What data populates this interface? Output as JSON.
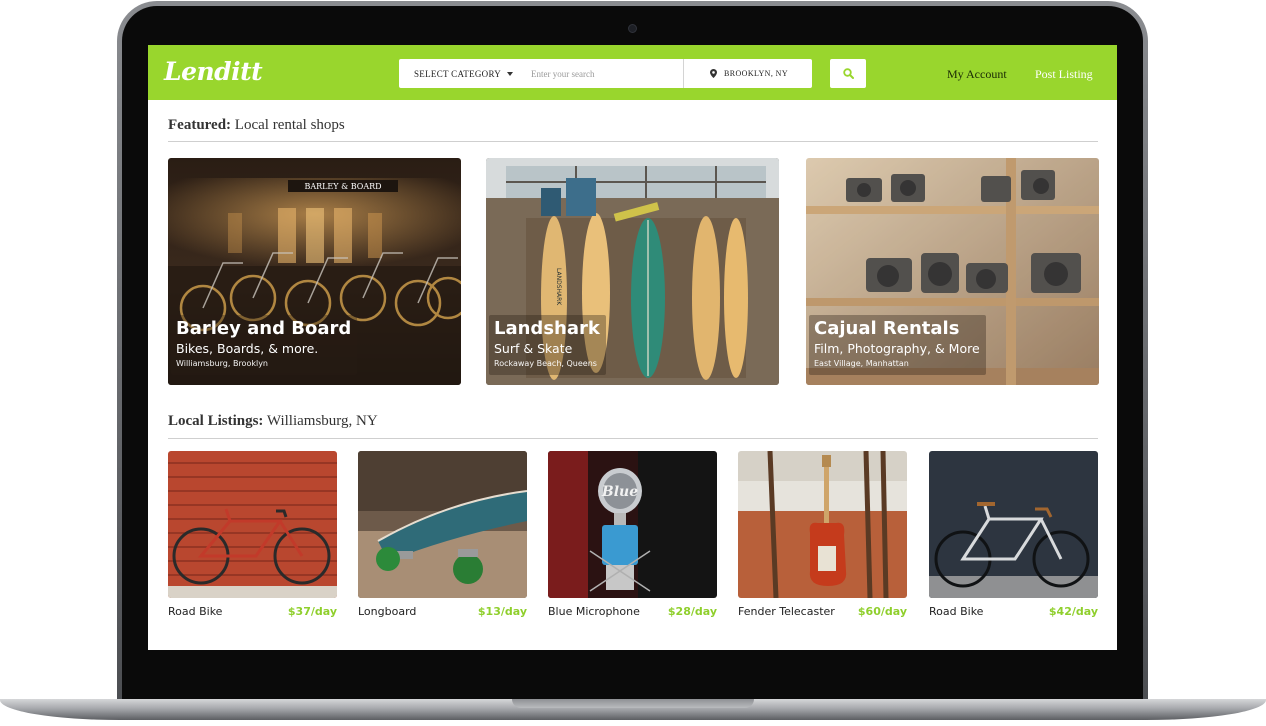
{
  "app": {
    "logo_text": "Lenditt",
    "accent_color": "#99d62d",
    "price_color": "#8fcf2c"
  },
  "header": {
    "category_label": "SELECT CATEGORY",
    "search_placeholder": "Enter your search",
    "location_label": "BROOKLYN, NY",
    "search_button_icon": "search-icon",
    "nav": {
      "account_label": "My Account",
      "post_label": "Post Listing"
    }
  },
  "featured": {
    "heading_bold": "Featured:",
    "heading_rest": " Local rental shops",
    "shops": [
      {
        "name": "Barley and Board",
        "tagline": "Bikes, Boards, & more.",
        "location": "Williamsburg, Brooklyn",
        "sign_text": "BARLEY & BOARD"
      },
      {
        "name": "Landshark",
        "tagline": "Surf & Skate",
        "location": "Rockaway Beach, Queens",
        "board_text": "LANDSHARK"
      },
      {
        "name": "Cajual Rentals",
        "tagline": "Film, Photography, & More",
        "location": "East Village, Manhattan"
      }
    ]
  },
  "local": {
    "heading_bold": "Local Listings:",
    "heading_rest": " Williamsburg, NY",
    "listings": [
      {
        "name": "Road Bike",
        "price": "$37/day"
      },
      {
        "name": "Longboard",
        "price": "$13/day"
      },
      {
        "name": "Blue Microphone",
        "price": "$28/day",
        "brand_text": "Blue"
      },
      {
        "name": "Fender Telecaster",
        "price": "$60/day"
      },
      {
        "name": "Road Bike",
        "price": "$42/day"
      }
    ]
  }
}
